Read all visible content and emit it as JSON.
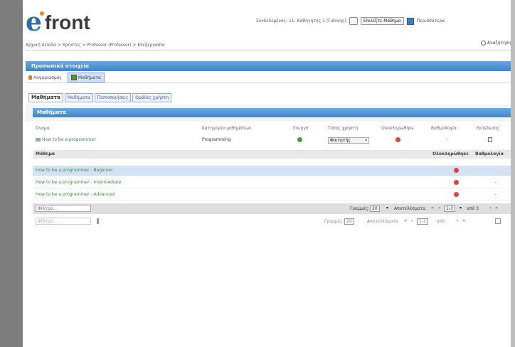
{
  "app": {
    "logo_text": "front"
  },
  "topbar": {
    "user_info": "Συνδεδεμένος: 11: Καθηγητής 1 (Γιάννης)",
    "course_select": "Επιλέξτε Μάθημα",
    "more": "Περισσότερα"
  },
  "breadcrumb": "Αρχική σελίδα > Χρήστες > Professor (Professor) > Επεξεργασία",
  "search": {
    "label": "Αναζήτηση"
  },
  "panel": {
    "title": "Προσωπικά στοιχεία"
  },
  "subtabs": [
    {
      "label": "Λογαριασμός"
    },
    {
      "label": "Μαθήματα"
    }
  ],
  "tabs": [
    {
      "label": "Μαθήματα"
    },
    {
      "label": "Μαθήματα"
    },
    {
      "label": "Πιστοποιήσεις"
    },
    {
      "label": "Ομάδες χρήστη"
    }
  ],
  "section": {
    "title": "Μαθήματα"
  },
  "courses_table": {
    "headers": [
      "Όνομα",
      "Κατηγορία μαθημάτων",
      "Ενεργό",
      "Τύπος χρήστη",
      "Ολοκληρώθηκε",
      "Βαθμολογία",
      "Εκτέλεσης"
    ],
    "row": {
      "name": "How to be a programmer",
      "category": "Programming",
      "role": "Φοιτητής",
      "score": "-"
    }
  },
  "lessons": {
    "headers": [
      "Μάθημα",
      "Ολοκληρώθηκε",
      "Βαθμολογία"
    ],
    "rows": [
      {
        "name": "How to be a programmer - Beginner",
        "score": ""
      },
      {
        "name": "How to be a programmer - Intermediate",
        "score": "-"
      },
      {
        "name": "How to be a programmer - Advanced",
        "score": "-"
      }
    ]
  },
  "pager": {
    "filter_placeholder": "Φίλτρο...",
    "rows_label": "Γραμμές:",
    "rows_value": "20",
    "page_label": "Αποτελέσματα",
    "range": "1-3",
    "of": "από 3"
  },
  "pager2": {
    "filter_placeholder": "Φίλτρο...",
    "rows_label": "Γραμμές:",
    "rows_value": "20",
    "page_label": "Αποτελέσματα",
    "range": "1-1",
    "of": "από"
  }
}
